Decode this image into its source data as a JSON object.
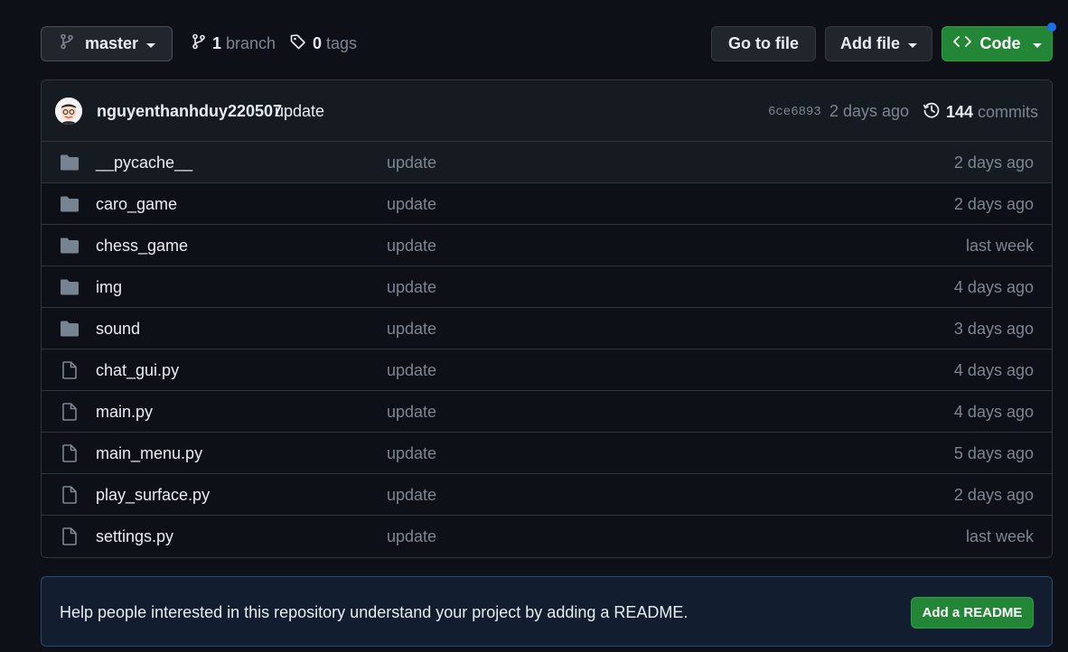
{
  "toolbar": {
    "branch_name": "master",
    "branches_count": "1",
    "branches_label": "branch",
    "tags_count": "0",
    "tags_label": "tags",
    "goto_file_label": "Go to file",
    "add_file_label": "Add file",
    "code_label": "Code"
  },
  "latest_commit": {
    "author": "nguyenthanhduy220507",
    "message": "update",
    "hash": "6ce6893",
    "time": "2 days ago",
    "commits_count": "144",
    "commits_label": "commits"
  },
  "files": [
    {
      "name": "__pycache__",
      "type": "folder",
      "message": "update",
      "age": "2 days ago"
    },
    {
      "name": "caro_game",
      "type": "folder",
      "message": "update",
      "age": "2 days ago"
    },
    {
      "name": "chess_game",
      "type": "folder",
      "message": "update",
      "age": "last week"
    },
    {
      "name": "img",
      "type": "folder",
      "message": "update",
      "age": "4 days ago"
    },
    {
      "name": "sound",
      "type": "folder",
      "message": "update",
      "age": "3 days ago"
    },
    {
      "name": "chat_gui.py",
      "type": "file",
      "message": "update",
      "age": "4 days ago"
    },
    {
      "name": "main.py",
      "type": "file",
      "message": "update",
      "age": "4 days ago"
    },
    {
      "name": "main_menu.py",
      "type": "file",
      "message": "update",
      "age": "5 days ago"
    },
    {
      "name": "play_surface.py",
      "type": "file",
      "message": "update",
      "age": "2 days ago"
    },
    {
      "name": "settings.py",
      "type": "file",
      "message": "update",
      "age": "last week"
    }
  ],
  "readme": {
    "prompt": "Help people interested in this repository understand your project by adding a README.",
    "button_label": "Add a README"
  },
  "colors": {
    "background": "#0d1117",
    "accent_green": "#238636",
    "muted_text": "#7d8590",
    "border": "#30363d",
    "notification_blue": "#1f6feb"
  }
}
